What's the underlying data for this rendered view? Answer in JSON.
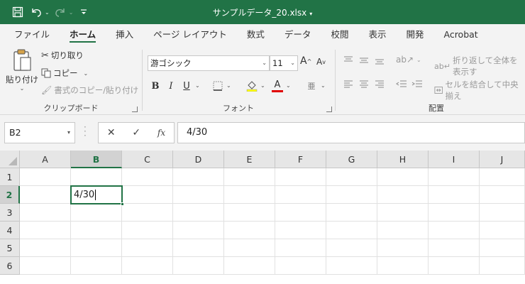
{
  "titlebar": {
    "filename": "サンプルデータ_20.xlsx",
    "bg_color": "#217346",
    "icons": [
      "save-icon",
      "undo-icon",
      "redo-icon",
      "customize-qat-icon"
    ]
  },
  "tabs": [
    {
      "label": "ファイル"
    },
    {
      "label": "ホーム",
      "active": true
    },
    {
      "label": "挿入"
    },
    {
      "label": "ページ レイアウト"
    },
    {
      "label": "数式"
    },
    {
      "label": "データ"
    },
    {
      "label": "校閲"
    },
    {
      "label": "表示"
    },
    {
      "label": "開発"
    },
    {
      "label": "Acrobat"
    }
  ],
  "ribbon": {
    "clipboard": {
      "group_label": "クリップボード",
      "paste_label": "貼り付け",
      "cut_label": "切り取り",
      "copy_label": "コピー",
      "format_painter_label": "書式のコピー/貼り付け"
    },
    "font": {
      "group_label": "フォント",
      "font_name": "游ゴシック",
      "font_size": "11",
      "bold": "B",
      "italic": "I",
      "underline": "U",
      "font_color_glyph": "A",
      "phonetic_glyph": "亜"
    },
    "alignment": {
      "group_label": "配置",
      "wrap_text_label": "折り返して全体を表示す",
      "merge_center_label": "セルを結合して中央揃え"
    }
  },
  "formula_bar": {
    "name_box": "B2",
    "formula_value": "4/30",
    "fx_label": "fx"
  },
  "grid": {
    "columns": [
      "A",
      "B",
      "C",
      "D",
      "E",
      "F",
      "G",
      "H",
      "I",
      "J"
    ],
    "rows": [
      "1",
      "2",
      "3",
      "4",
      "5",
      "6"
    ],
    "selected_column": "B",
    "selected_row": "2",
    "active_cell_value": "4/30",
    "accent_color": "#217346"
  }
}
